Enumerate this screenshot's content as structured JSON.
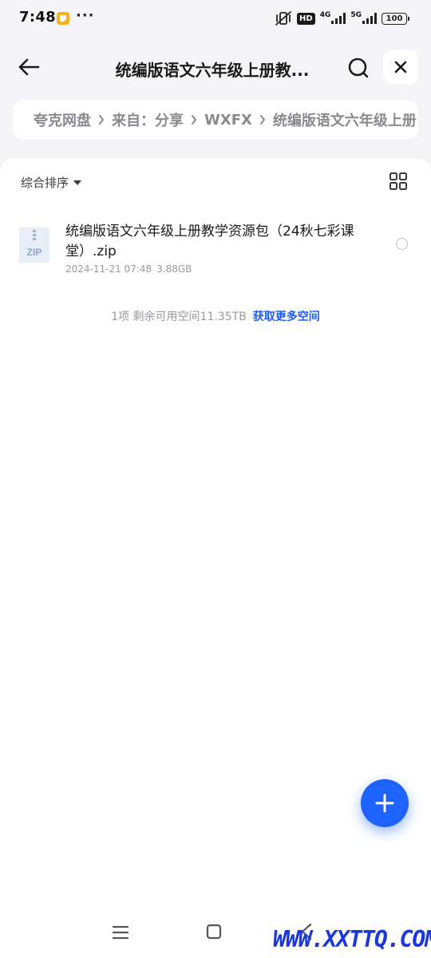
{
  "status_bar": {
    "time": "7:48",
    "more": "···",
    "hd": "HD",
    "net1": "4G",
    "net2": "5G",
    "battery": "100"
  },
  "header": {
    "title": "统编版语文六年级上册教..."
  },
  "breadcrumb": {
    "items": [
      "夸克网盘",
      "来自：分享",
      "WXFX",
      "统编版语文六年级上册"
    ]
  },
  "toolbar": {
    "sort_label": "综合排序"
  },
  "file": {
    "name": "统编版语文六年级上册教学资源包（24秋七彩课堂）.zip",
    "icon_label": "ZIP",
    "date": "2024-11-21 07:48",
    "size": "3.88GB"
  },
  "footer": {
    "info": "1项 剩余可用空间11.35TB",
    "link": "获取更多空间"
  },
  "watermark": "WWW.XXTTQ.COM",
  "colors": {
    "accent": "#1e63ff",
    "link": "#1d5dff",
    "background_top": "#f5f5f7"
  }
}
